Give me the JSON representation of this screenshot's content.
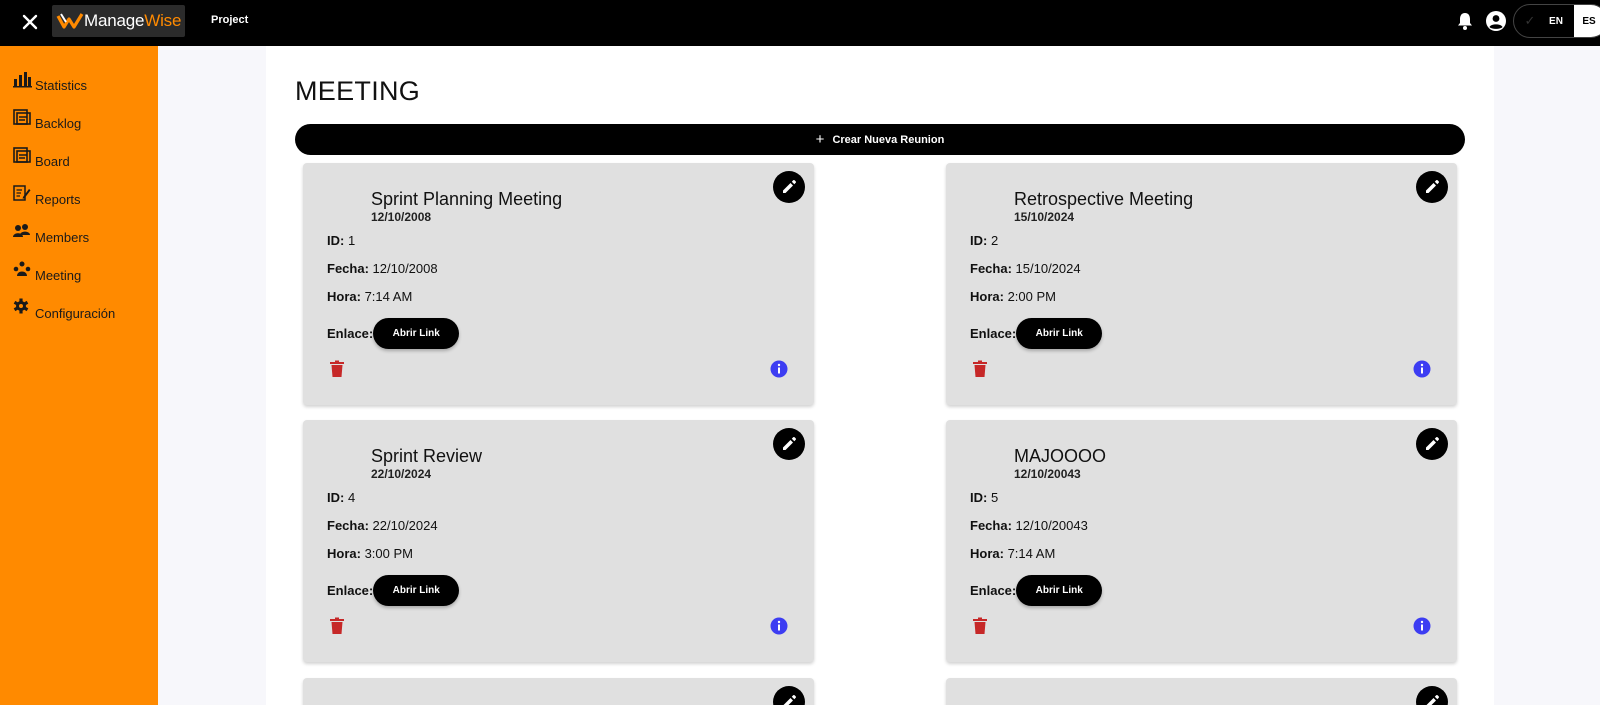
{
  "header": {
    "logo_text_1": "Manage",
    "logo_text_2": "Wise",
    "project_label": "Project",
    "lang_en": "EN",
    "lang_es": "ES"
  },
  "sidebar": {
    "items": [
      {
        "label": "Statistics",
        "icon": "bar-chart-icon"
      },
      {
        "label": "Backlog",
        "icon": "backlog-icon"
      },
      {
        "label": "Board",
        "icon": "board-icon"
      },
      {
        "label": "Reports",
        "icon": "reports-icon"
      },
      {
        "label": "Members",
        "icon": "members-icon"
      },
      {
        "label": "Meeting",
        "icon": "meeting-icon"
      },
      {
        "label": "Configuración",
        "icon": "gear-icon"
      }
    ]
  },
  "main": {
    "title": "MEETING",
    "create_label": "Crear Nueva Reunion",
    "labels": {
      "id": "ID:",
      "fecha": "Fecha:",
      "hora": "Hora:",
      "enlace": "Enlace:",
      "open_link": "Abrir Link"
    },
    "meetings": [
      {
        "title": "Sprint Planning Meeting",
        "subtitle": "12/10/2008",
        "id": "1",
        "fecha": "12/10/2008",
        "hora": "7:14 AM"
      },
      {
        "title": "Retrospective Meeting",
        "subtitle": "15/10/2024",
        "id": "2",
        "fecha": "15/10/2024",
        "hora": "2:00 PM"
      },
      {
        "title": "Sprint Review",
        "subtitle": "22/10/2024",
        "id": "4",
        "fecha": "22/10/2024",
        "hora": "3:00 PM"
      },
      {
        "title": "MAJOOOO",
        "subtitle": "12/10/20043",
        "id": "5",
        "fecha": "12/10/20043",
        "hora": "7:14 AM"
      }
    ]
  },
  "colors": {
    "accent": "#ff8a00",
    "delete": "#c62828",
    "info": "#3d3df2"
  }
}
